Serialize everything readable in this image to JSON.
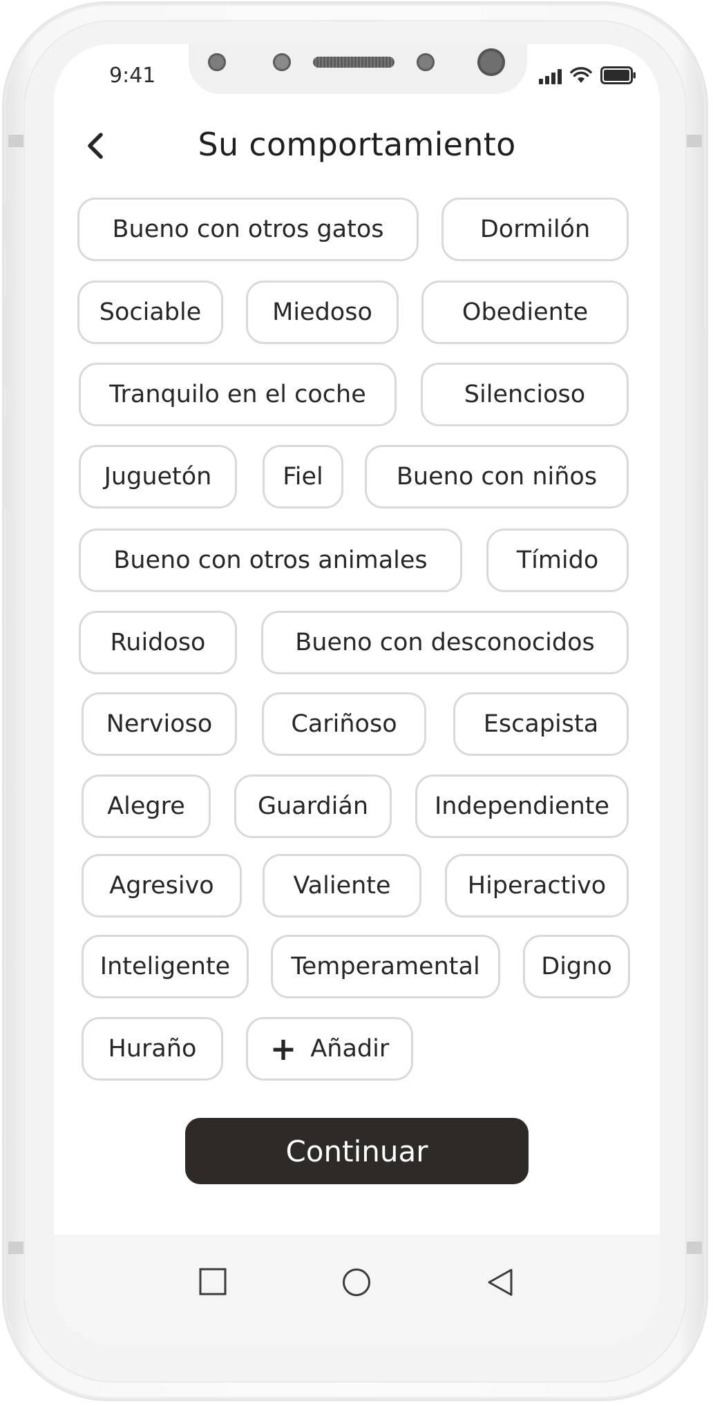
{
  "status": {
    "time": "9:41"
  },
  "header": {
    "title": "Su comportamiento"
  },
  "chips": [
    "Bueno con otros gatos",
    "Dormilón",
    "Sociable",
    "Miedoso",
    "Obediente",
    "Tranquilo en el coche",
    "Silencioso",
    "Juguetón",
    "Fiel",
    "Bueno con niños",
    "Bueno con otros animales",
    "Tímido",
    "Ruidoso",
    "Bueno con desconocidos",
    "Nervioso",
    "Cariñoso",
    "Escapista",
    "Alegre",
    "Guardián",
    "Independiente",
    "Agresivo",
    "Valiente",
    "Hiperactivo",
    "Inteligente",
    "Temperamental",
    "Digno",
    "Huraño"
  ],
  "add": {
    "label": "Añadir"
  },
  "continue_label": "Continuar",
  "icons": {
    "back": "chevron-left-icon",
    "add": "plus-icon",
    "nav_recent": "square-icon",
    "nav_home": "circle-icon",
    "nav_back": "triangle-left-icon"
  },
  "colors": {
    "primary_button": "#2d2a27",
    "chip_border": "#d9d9d9",
    "text": "#262626"
  }
}
